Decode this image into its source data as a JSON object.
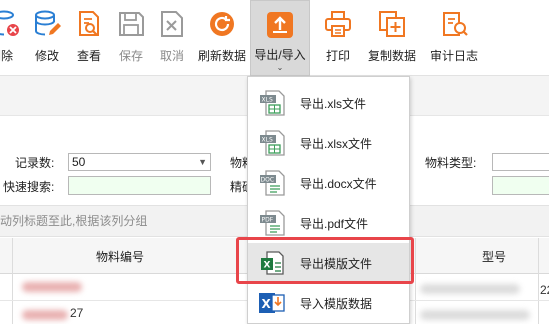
{
  "toolbar": {
    "delete": "删除",
    "edit": "修改",
    "view": "查看",
    "save": "保存",
    "cancel": "取消",
    "refresh": "刷新数据",
    "export_import": "导出/导入",
    "print": "打印",
    "copy": "复制数据",
    "audit": "审计日志"
  },
  "filters": {
    "record_count_label": "记录数:",
    "record_count_value": "50",
    "quick_search_label": "快速搜索:",
    "material_label_partial": "物料",
    "precise_label_partial": "精确",
    "material_type_label": "物料类型:"
  },
  "group_hint": "拖动列标题至此,根据该列分组",
  "grid": {
    "col_material_no": "物料编号",
    "col_model": "型号",
    "row1_tail": "22",
    "row2_mid": "27"
  },
  "dropdown": {
    "items": [
      {
        "label": "导出.xls文件",
        "icon": "xls-file-icon"
      },
      {
        "label": "导出.xlsx文件",
        "icon": "xlsx-file-icon"
      },
      {
        "label": "导出.docx文件",
        "icon": "docx-file-icon"
      },
      {
        "label": "导出.pdf文件",
        "icon": "pdf-file-icon"
      },
      {
        "label": "导出模版文件",
        "icon": "excel-template-icon"
      },
      {
        "label": "导入模版数据",
        "icon": "excel-import-icon"
      }
    ]
  },
  "colors": {
    "accent_orange": "#f07722",
    "icon_blue": "#2a7fd4",
    "highlight_red": "#e8454a",
    "excel_green": "#1f7a3f"
  }
}
